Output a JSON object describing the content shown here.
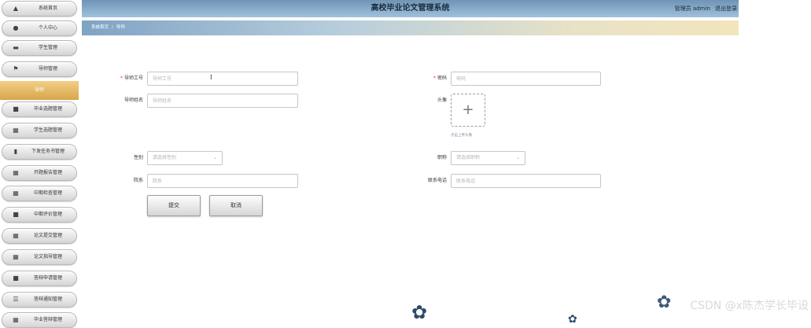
{
  "app": {
    "title": "高校毕业论文管理系统",
    "user_role": "管理员",
    "user_name": "admin",
    "logout_label": "退出登录"
  },
  "breadcrumb": [
    "系统首页",
    "导师"
  ],
  "sidebar": {
    "items": [
      {
        "label": "系统首页",
        "icon": "home-icon",
        "glyph": "▲"
      },
      {
        "label": "个人中心",
        "icon": "user-icon",
        "glyph": "●"
      },
      {
        "label": "学生管理",
        "icon": "student-icon",
        "glyph": "▬"
      },
      {
        "label": "导师管理",
        "icon": "flag-icon",
        "glyph": "⚑"
      },
      {
        "label": "毕业选题管理",
        "icon": "list-icon",
        "glyph": "■"
      },
      {
        "label": "学生选题管理",
        "icon": "grid-icon",
        "glyph": "▦"
      },
      {
        "label": "下发任务书管理",
        "icon": "bar-chart-icon",
        "glyph": "▮"
      },
      {
        "label": "开题报告管理",
        "icon": "grid-icon",
        "glyph": "▦"
      },
      {
        "label": "中期检查管理",
        "icon": "grid-icon",
        "glyph": "▦"
      },
      {
        "label": "中期评价管理",
        "icon": "doc-icon",
        "glyph": "■"
      },
      {
        "label": "论文提交管理",
        "icon": "grid-icon",
        "glyph": "▦"
      },
      {
        "label": "论文指导管理",
        "icon": "grid-icon",
        "glyph": "▦"
      },
      {
        "label": "答辩申请管理",
        "icon": "doc-icon",
        "glyph": "■"
      },
      {
        "label": "答辩通知管理",
        "icon": "menu-icon",
        "glyph": "☰"
      },
      {
        "label": "毕业答辩管理",
        "icon": "grid-icon",
        "glyph": "▦"
      }
    ],
    "active_sub": "导师"
  },
  "form": {
    "mentor_id": {
      "label": "导师工号",
      "placeholder": "导师工号",
      "value": ""
    },
    "password": {
      "label": "密码",
      "placeholder": "密码",
      "value": ""
    },
    "mentor_name": {
      "label": "导师姓名",
      "placeholder": "导师姓名",
      "value": ""
    },
    "avatar": {
      "label": "头像",
      "hint": "点击上传头像",
      "plus": "+"
    },
    "gender": {
      "label": "性别",
      "placeholder": "请选择性别"
    },
    "title": {
      "label": "职称",
      "placeholder": "请选择职称"
    },
    "department": {
      "label": "院系",
      "placeholder": "院系",
      "value": ""
    },
    "phone": {
      "label": "联系电话",
      "placeholder": "联系电话",
      "value": ""
    },
    "required_mark": "*"
  },
  "buttons": {
    "submit": "提交",
    "cancel": "取消"
  },
  "watermark": "CSDN @x陈杰学长毕设"
}
